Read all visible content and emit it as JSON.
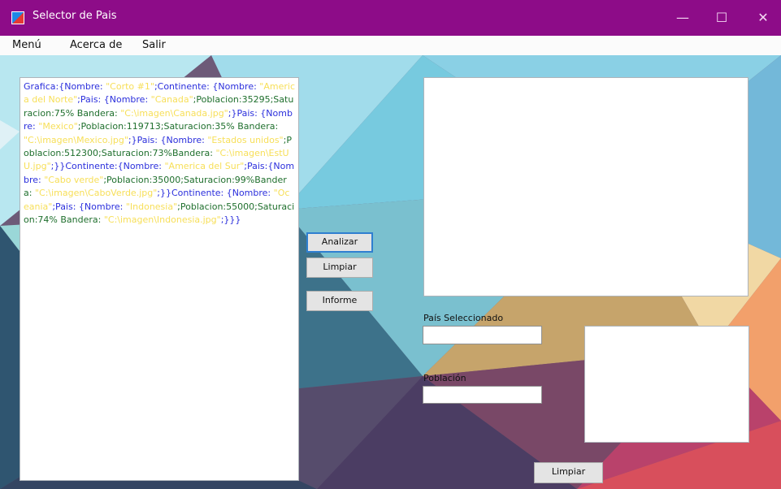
{
  "window": {
    "title": "Selector de Pais",
    "controls": [
      "—",
      "☐",
      "✕"
    ]
  },
  "menu": [
    "Menú",
    "Acerca de",
    "Salir"
  ],
  "output": {
    "segments": [
      {
        "text": "Grafica:{Nombre: ",
        "style": "k"
      },
      {
        "text": "\"Corto #1\"",
        "style": "v"
      },
      {
        "text": ";Continente: {Nombre: ",
        "style": "k"
      },
      {
        "text": "\"America del Norte\"",
        "style": "v"
      },
      {
        "text": ";Pais: {Nombre: ",
        "style": "k"
      },
      {
        "text": "\"Canada\"",
        "style": "v"
      },
      {
        "text": ";Poblacion:35295;Saturacion:75% Bandera: ",
        "style": "n"
      },
      {
        "text": "\"C:\\imagen\\Canada.jpg\"",
        "style": "v"
      },
      {
        "text": ";}Pais: {Nombre: ",
        "style": "k"
      },
      {
        "text": "\"Mexico\"",
        "style": "v"
      },
      {
        "text": ";Poblacion:119713;Saturacion:35% Bandera: ",
        "style": "n"
      },
      {
        "text": "\"C:\\imagen\\Mexico.jpg\"",
        "style": "v"
      },
      {
        "text": ";}Pais: {Nombre: ",
        "style": "k"
      },
      {
        "text": "\"Estados unidos\"",
        "style": "v"
      },
      {
        "text": ";Poblacion:512300;Saturacion:73%Bandera: ",
        "style": "n"
      },
      {
        "text": "\"C:\\imagen\\EstUU.jpg\"",
        "style": "v"
      },
      {
        "text": ";}}Continente:{Nombre: ",
        "style": "k"
      },
      {
        "text": "\"America del Sur\"",
        "style": "v"
      },
      {
        "text": ";Pais:{Nombre: ",
        "style": "k"
      },
      {
        "text": "\"Cabo verde\"",
        "style": "v"
      },
      {
        "text": ";Poblacion:35000;Saturacion:99%Bandera: ",
        "style": "n"
      },
      {
        "text": "\"C:\\imagen\\CaboVerde.jpg\"",
        "style": "v"
      },
      {
        "text": ";}}Continente: {Nombre: ",
        "style": "k"
      },
      {
        "text": "\"Oceania\"",
        "style": "v"
      },
      {
        "text": ";Pais: {Nombre: ",
        "style": "k"
      },
      {
        "text": "\"Indonesia\"",
        "style": "v"
      },
      {
        "text": ";Poblacion:55000;Saturacion:74% Bandera: ",
        "style": "n"
      },
      {
        "text": "\"C:\\imagen\\Indonesia.jpg\"",
        "style": "v"
      },
      {
        "text": ";}}}",
        "style": "k"
      }
    ]
  },
  "buttons": {
    "analizar": "Analizar",
    "limpiar": "Limpiar",
    "informe": "Informe",
    "limpiar_bottom": "Limpiar"
  },
  "labels": {
    "pais_seleccionado": "País Seleccionado",
    "poblacion": "Población"
  },
  "inputs": {
    "pais_seleccionado": "",
    "poblacion": ""
  },
  "colors": {
    "titlebar": "#8d0c88",
    "value_text": "#f7df58",
    "keyword_text": "#2b2fdc",
    "numeric_text": "#1f6f2d"
  }
}
